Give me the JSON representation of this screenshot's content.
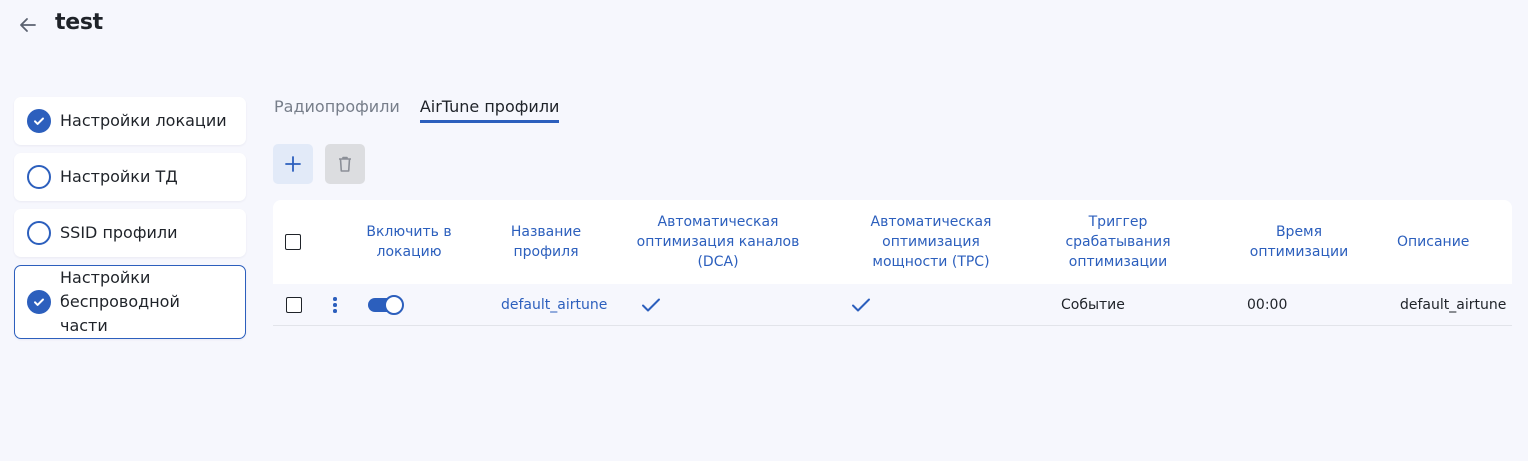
{
  "header": {
    "title": "test",
    "back_icon": "arrow-left-icon"
  },
  "steps": [
    {
      "label": "Настройки локации",
      "checked": true
    },
    {
      "label": "Настройки ТД",
      "checked": false
    },
    {
      "label": "SSID профили",
      "checked": false
    },
    {
      "label": "Настройки беспроводной части",
      "checked": true,
      "active": true
    }
  ],
  "tabs": [
    {
      "label": "Радиопрофили",
      "active": false
    },
    {
      "label": "AirTune профили",
      "active": true
    }
  ],
  "toolbar": {
    "add_icon": "plus-icon",
    "delete_icon": "trash-icon"
  },
  "table": {
    "columns": [
      "Включить в локацию",
      "Название профиля",
      "Автоматическая оптимизация каналов (DCA)",
      "Автоматическая оптимизация мощности (TPC)",
      "Триггер срабатывания оптимизации",
      "Время оптимизации",
      "Описание"
    ],
    "rows": [
      {
        "enabled": true,
        "name": "default_airtune",
        "dca": true,
        "tpc": true,
        "trigger": "Событие",
        "time": "00:00",
        "description": "default_airtune"
      }
    ]
  },
  "colors": {
    "accent": "#2c5fbd",
    "background": "#f6f7fd"
  }
}
